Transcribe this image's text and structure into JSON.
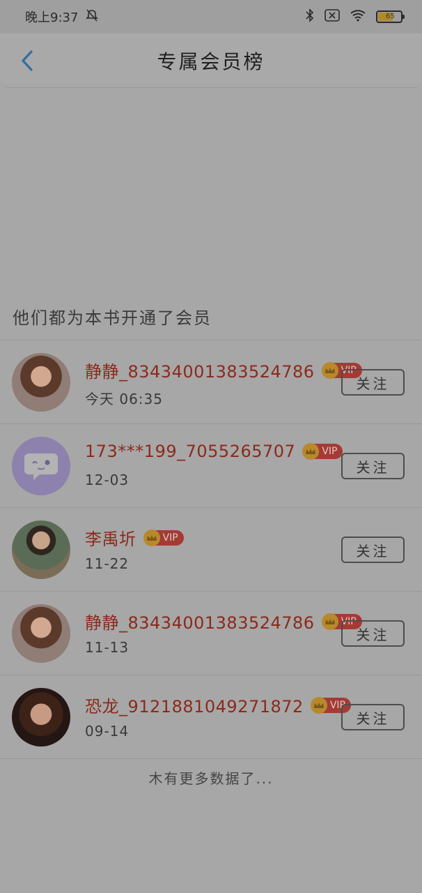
{
  "status_bar": {
    "time": "晚上9:37",
    "battery": "65"
  },
  "header": {
    "title": "专属会员榜"
  },
  "section_title": "他们都为本书开通了会员",
  "members": [
    {
      "name": "静静_83434001383524786",
      "date": "今天 06:35",
      "vip": "VIP",
      "follow": "关注"
    },
    {
      "name": "173***199_7055265707",
      "date": "12-03",
      "vip": "VIP",
      "follow": "关注"
    },
    {
      "name": "李禹圻",
      "date": "11-22",
      "vip": "VIP",
      "follow": "关注"
    },
    {
      "name": "静静_83434001383524786",
      "date": "11-13",
      "vip": "VIP",
      "follow": "关注"
    },
    {
      "name": "恐龙_9121881049271872",
      "date": "09-14",
      "vip": "VIP",
      "follow": "关注"
    }
  ],
  "footer": "木有更多数据了...",
  "colors": {
    "overlay_bg": "#a7a7a7",
    "username": "#8b2a1b",
    "vip_badge": "#a53a34",
    "crown": "#b8892c",
    "back_arrow": "#2f6fa0"
  },
  "icons": [
    "back-arrow-icon",
    "alarm-off-icon",
    "bluetooth-icon",
    "sim-x-icon",
    "wifi-icon",
    "battery-icon",
    "crown-icon",
    "chat-bubble-icon"
  ]
}
